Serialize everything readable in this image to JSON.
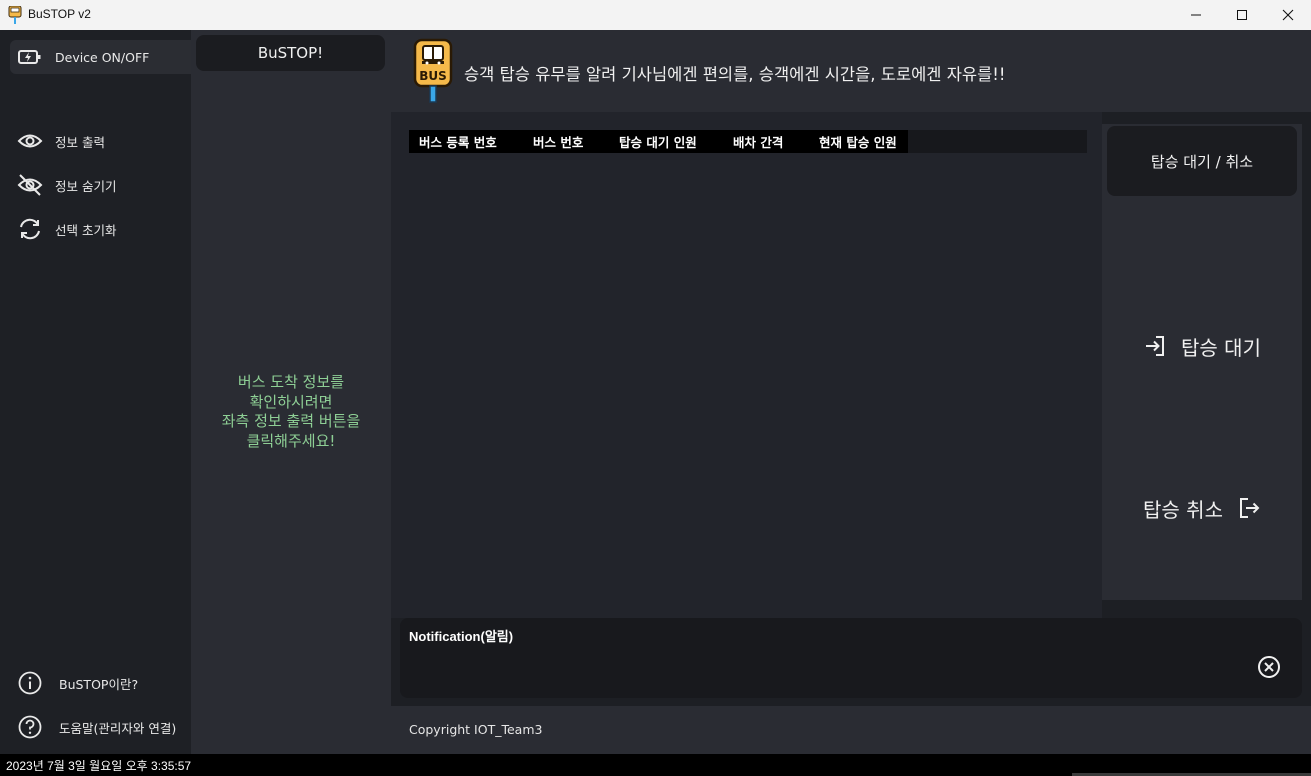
{
  "window": {
    "title": "BuSTOP v2"
  },
  "sidebar": {
    "items": [
      {
        "label": "Device ON/OFF",
        "icon": "power-charging-icon"
      },
      {
        "label": "정보 출력",
        "icon": "eye-icon"
      },
      {
        "label": "정보 숨기기",
        "icon": "eye-off-icon"
      },
      {
        "label": "선택 초기화",
        "icon": "refresh-icon"
      },
      {
        "label": "BuSTOP이란?",
        "icon": "info-icon"
      },
      {
        "label": "도움말(관리자와 연결)",
        "icon": "help-icon"
      }
    ]
  },
  "infocol": {
    "button_label": "BuSTOP!",
    "hint": "버스 도착 정보를\n확인하시려면\n좌측 정보 출력 버튼을\n클릭해주세요!"
  },
  "header": {
    "logo_text": "BUS",
    "slogan": "승객 탑승 유무를 알려 기사님에겐 편의를, 승객에겐 시간을, 도로에겐 자유를!!"
  },
  "table": {
    "columns": [
      "버스 등록 번호",
      "버스 번호",
      "탑승 대기 인원",
      "배차 간격",
      "현재 탑승 인원"
    ]
  },
  "actions": {
    "toggle_label": "탑승 대기 / 취소",
    "wait_label": "탑승 대기",
    "cancel_label": "탑승 취소"
  },
  "notification": {
    "title": "Notification(알림)"
  },
  "footer": {
    "copyright": "Copyright IOT_Team3"
  },
  "statusbar": {
    "datetime": "2023년 7월 3일 월요일 오후 3:35:57"
  },
  "colors": {
    "hint_green": "#8ecf95",
    "logo_yellow": "#f5b94a",
    "logo_blue": "#3aa7e8"
  }
}
